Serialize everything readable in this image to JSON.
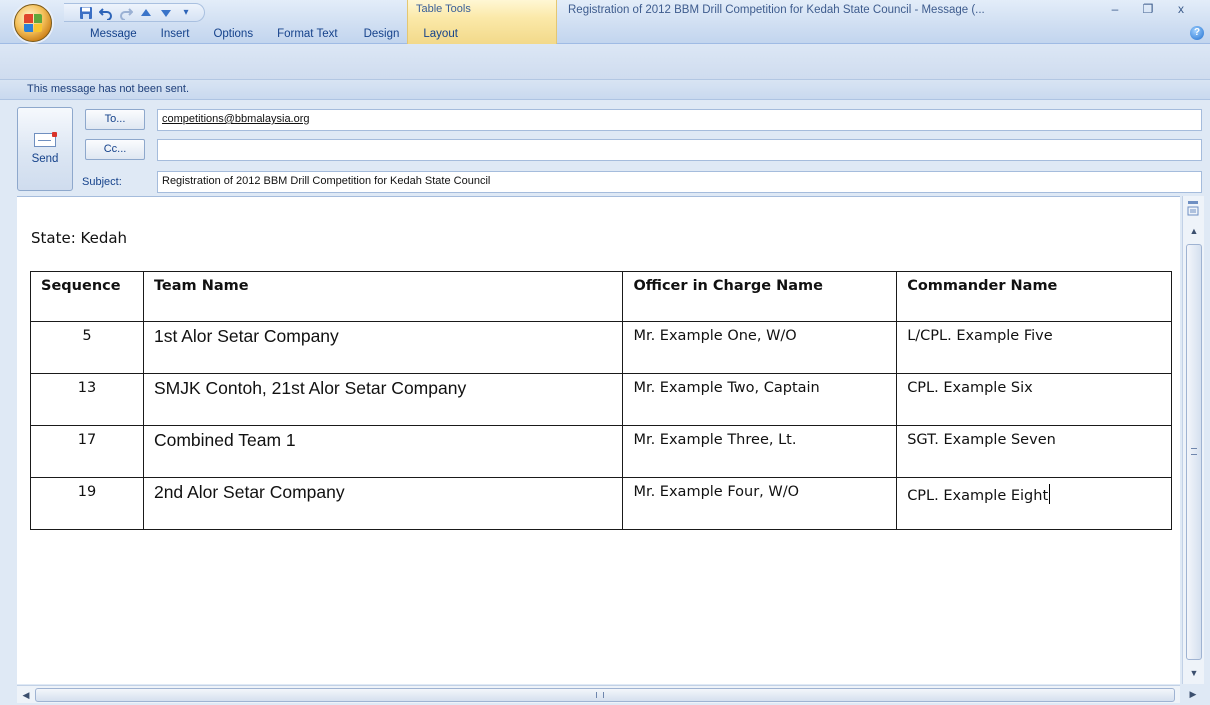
{
  "titlebar": {
    "title": "Registration of 2012 BBM Drill Competition for Kedah State Council - Message (...",
    "contextual_group": "Table Tools",
    "minimize": "–",
    "restore": "❐",
    "close": "x"
  },
  "ribbon": {
    "tabs": [
      "Message",
      "Insert",
      "Options",
      "Format Text",
      "Design",
      "Layout"
    ]
  },
  "notice": "This message has not been sent.",
  "compose": {
    "send_label": "Send",
    "to_button": "To...",
    "cc_button": "Cc...",
    "subject_label": "Subject:",
    "to_value": "competitions@bbmalaysia.org",
    "cc_value": "",
    "subject_value": "Registration of 2012 BBM Drill Competition for Kedah State Council"
  },
  "body": {
    "state_line": "State: Kedah",
    "columns": [
      "Sequence",
      "Team Name",
      "Officer in Charge Name",
      "Commander Name"
    ],
    "rows": [
      [
        "5",
        "1st Alor Setar Company",
        "Mr. Example One, W/O",
        "L/CPL. Example Five"
      ],
      [
        "13",
        "SMJK Contoh, 21st Alor Setar Company",
        "Mr. Example Two, Captain",
        "CPL. Example Six"
      ],
      [
        "17",
        "Combined Team 1",
        "Mr. Example Three, Lt.",
        "SGT. Example Seven"
      ],
      [
        "19",
        "2nd Alor Setar Company",
        "Mr. Example Four, W/O",
        "CPL. Example Eight"
      ]
    ]
  },
  "icons": {
    "office_button": "office-logo-icon",
    "save": "save-icon",
    "undo": "undo-icon",
    "redo": "redo-icon",
    "prev": "previous-item-icon",
    "next": "next-item-icon",
    "help": "help-icon",
    "send": "envelope-icon"
  }
}
